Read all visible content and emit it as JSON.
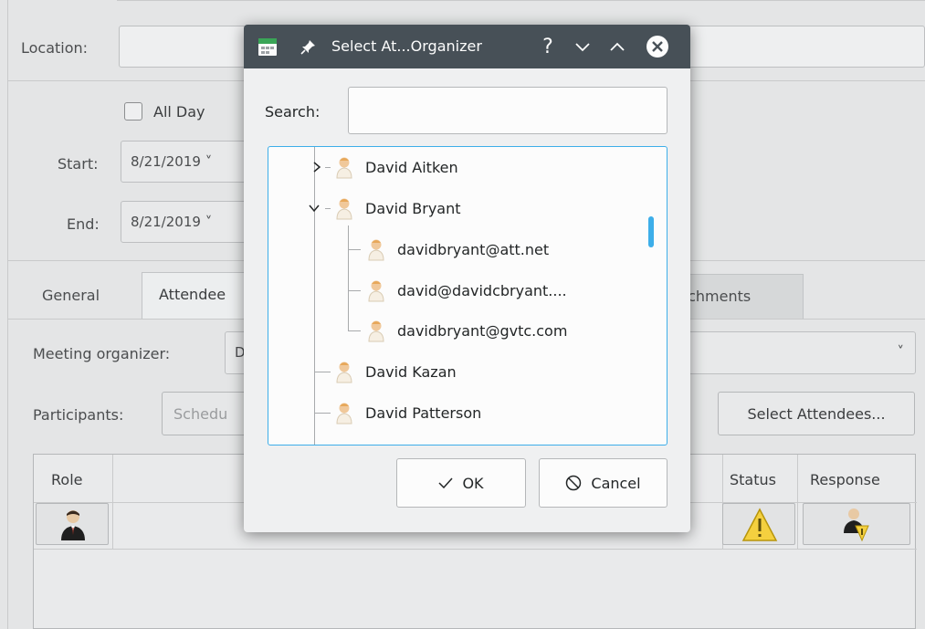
{
  "background": {
    "location_label": "Location:",
    "all_day_label": "All Day",
    "start_label": "Start:",
    "start_date": "8/21/2019",
    "end_label": "End:",
    "end_date": "8/21/2019",
    "tabs": [
      "General",
      "Attendees",
      "Attachments"
    ],
    "tab_attachments_visible": "tachments",
    "tab_attendees_visible": "Attendee",
    "meeting_organizer_label": "Meeting organizer:",
    "meeting_organizer_value": "D",
    "participants_label": "Participants:",
    "schedule_button_visible": "Schedu",
    "select_attendees_button": "Select Attendees...",
    "table_headers": {
      "role": "Role",
      "status": "Status",
      "response": "Response"
    }
  },
  "dialog": {
    "title": "Select At...Organizer",
    "title_buttons": [
      "help",
      "minimize",
      "maximize",
      "close"
    ],
    "search_label": "Search:",
    "search_value": "",
    "tree_items": [
      {
        "label": "David Aitken",
        "level": 0,
        "expander": "collapsed"
      },
      {
        "label": "David Bryant",
        "level": 0,
        "expander": "expanded"
      },
      {
        "label": "davidbryant@att.net",
        "level": 1
      },
      {
        "label": "david@davidcbryant....",
        "level": 1
      },
      {
        "label": "davidbryant@gvtc.com",
        "level": 1
      },
      {
        "label": "David Kazan",
        "level": 0
      },
      {
        "label": "David Patterson",
        "level": 0
      }
    ],
    "ok_label": "OK",
    "cancel_label": "Cancel"
  },
  "colors": {
    "accent": "#3daee9",
    "titlebar": "#475057",
    "dialog_bg": "#eff0f1",
    "warning": "#f4d03f"
  }
}
